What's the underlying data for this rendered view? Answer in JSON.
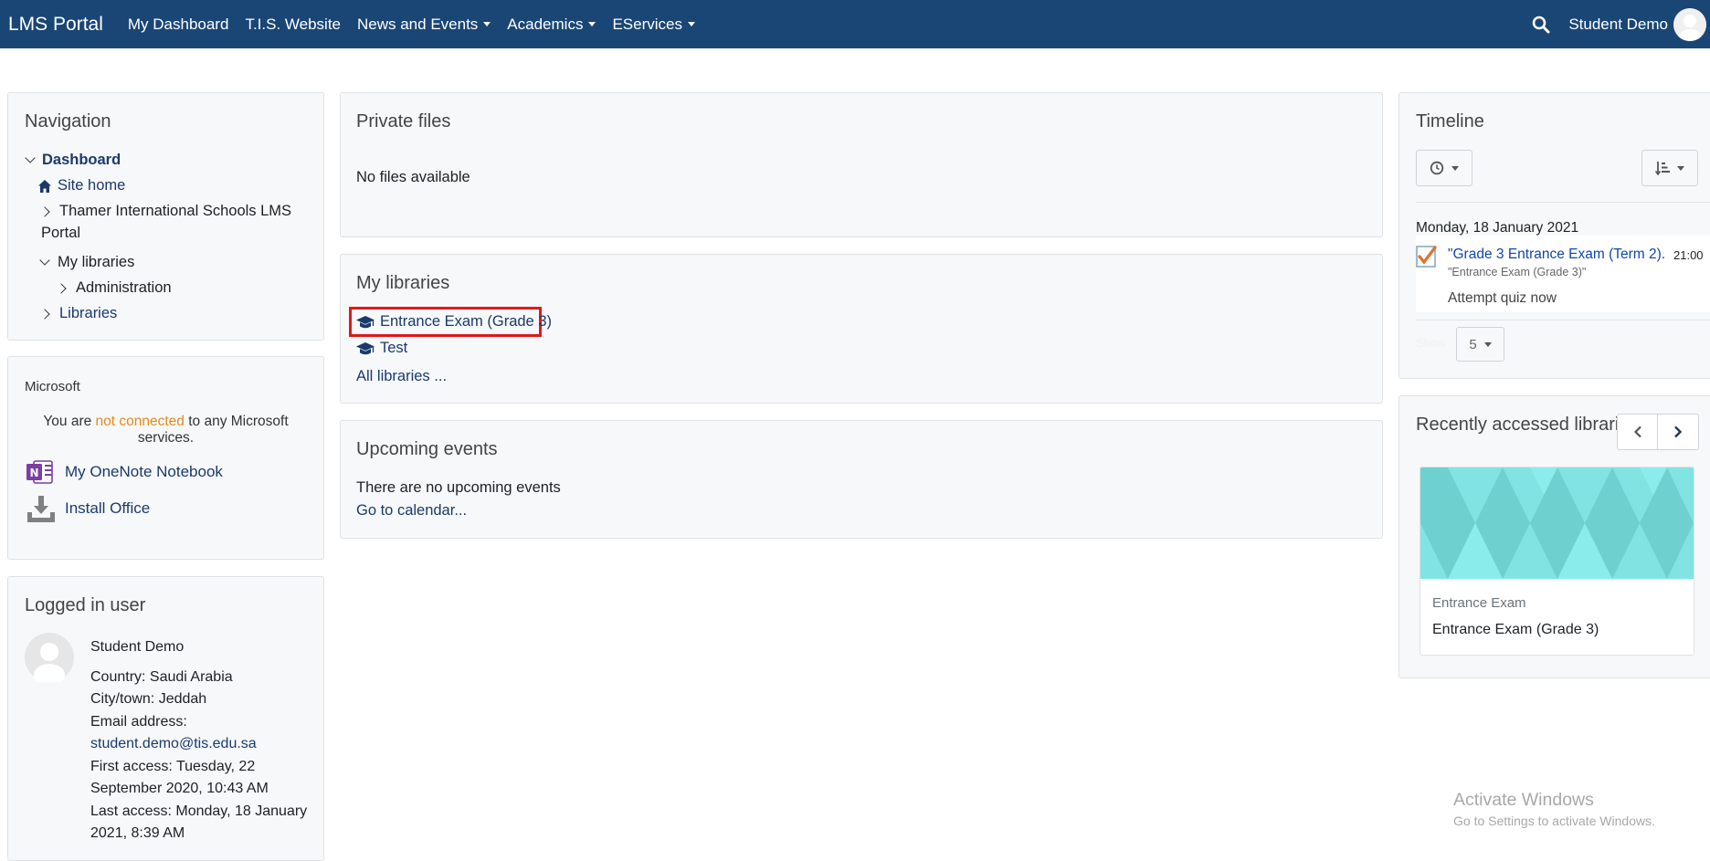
{
  "navbar": {
    "brand": "LMS Portal",
    "items": [
      {
        "label": "My Dashboard",
        "dropdown": false
      },
      {
        "label": "T.I.S. Website",
        "dropdown": false
      },
      {
        "label": "News and Events",
        "dropdown": true
      },
      {
        "label": "Academics",
        "dropdown": true
      },
      {
        "label": "EServices",
        "dropdown": true
      }
    ],
    "user_name": "Student Demo",
    "bg_color": "#1a4676"
  },
  "navigation": {
    "title": "Navigation",
    "dashboard": "Dashboard",
    "site_home": "Site home",
    "portal_line1": "Thamer International Schools LMS",
    "portal_line2": "Portal",
    "my_libraries": "My libraries",
    "administration": "Administration",
    "libraries": "Libraries"
  },
  "microsoft": {
    "title": "Microsoft",
    "status_prefix": "You are ",
    "status_highlight": "not connected",
    "status_suffix": " to any Microsoft",
    "status_line2": "services.",
    "onenote": "My OneNote Notebook",
    "install_office": "Install Office"
  },
  "logged_in_user": {
    "title": "Logged in user",
    "name": "Student Demo",
    "country": "Country: Saudi Arabia",
    "city": "City/town: Jeddah",
    "email_label": "Email address:",
    "email": "student.demo@tis.edu.sa",
    "first_access_1": "First access: Tuesday, 22",
    "first_access_2": "September 2020, 10:43 AM",
    "last_access_1": "Last access: Monday, 18 January",
    "last_access_2": "2021, 8:39 AM"
  },
  "private_files": {
    "title": "Private files",
    "empty": "No files available"
  },
  "my_libraries": {
    "title": "My libraries",
    "items": [
      "Entrance Exam (Grade 3)",
      "Test"
    ],
    "all": "All libraries ..."
  },
  "upcoming_events": {
    "title": "Upcoming events",
    "empty": "There are no upcoming events",
    "calendar": "Go to calendar..."
  },
  "timeline": {
    "title": "Timeline",
    "date": "Monday, 18 January 2021",
    "event_title": "\"Grade 3 Entrance Exam (Term 2)...",
    "event_time": "21:00",
    "event_course": "\"Entrance Exam (Grade 3)\"",
    "action": "Attempt quiz now",
    "show_label": "Show",
    "per_page": "5"
  },
  "recent": {
    "title": "Recently accessed libraries",
    "category": "Entrance Exam",
    "course": "Entrance Exam (Grade 3)"
  },
  "watermark": {
    "line1": "Activate Windows",
    "line2": "Go to Settings to activate Windows."
  }
}
